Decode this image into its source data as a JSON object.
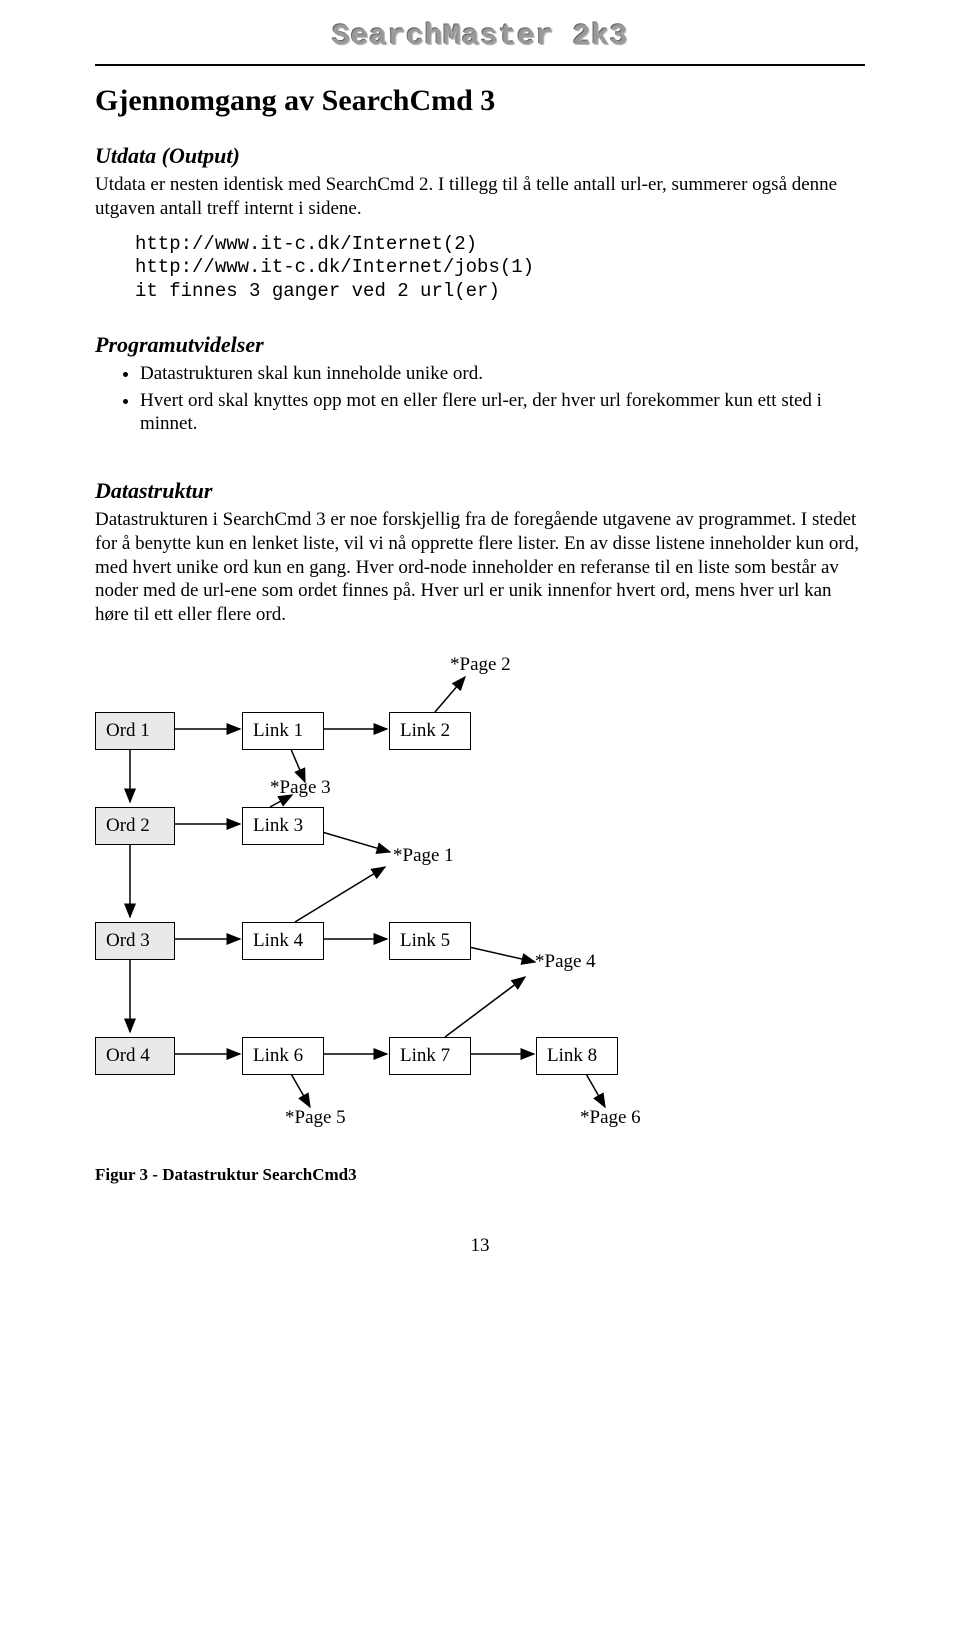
{
  "header": {
    "app_title": "SearchMaster 2k3"
  },
  "section": {
    "title": "Gjennomgang av SearchCmd 3"
  },
  "utdata": {
    "heading": "Utdata (Output)",
    "body": "Utdata er nesten identisk med SearchCmd 2. I tillegg til å telle antall url-er, summerer også denne utgaven antall treff internt i sidene.",
    "code": "http://www.it-c.dk/Internet(2)\nhttp://www.it-c.dk/Internet/jobs(1)\nit finnes 3 ganger ved 2 url(er)"
  },
  "programutvidelser": {
    "heading": "Programutvidelser",
    "bullets": [
      "Datastrukturen skal kun inneholde unike ord.",
      "Hvert ord skal knyttes opp mot en eller flere url-er, der hver url forekommer kun ett sted i minnet."
    ]
  },
  "datastruktur": {
    "heading": "Datastruktur",
    "body": "Datastrukturen i SearchCmd 3 er noe forskjellig fra de foregående utgavene av programmet. I stedet for å benytte kun en lenket liste, vil vi nå opprette flere lister. En av disse listene inneholder kun ord, med hvert unike ord kun en gang. Hver ord-node inneholder en referanse til en liste som består av noder med de url-ene som ordet finnes på. Hver url er unik innenfor hvert ord, mens hver url kan høre til ett eller flere ord."
  },
  "diagram": {
    "nodes": {
      "ord1": "Ord 1",
      "ord2": "Ord 2",
      "ord3": "Ord 3",
      "ord4": "Ord 4",
      "link1": "Link 1",
      "link2": "Link 2",
      "link3": "Link 3",
      "link4": "Link 4",
      "link5": "Link 5",
      "link6": "Link 6",
      "link7": "Link 7",
      "link8": "Link 8"
    },
    "pages": {
      "p1": "*Page 1",
      "p2": "*Page 2",
      "p3": "*Page 3",
      "p4": "*Page 4",
      "p5": "*Page 5",
      "p6": "*Page 6"
    },
    "caption": "Figur 3 - Datastruktur SearchCmd3"
  },
  "page_number": "13"
}
